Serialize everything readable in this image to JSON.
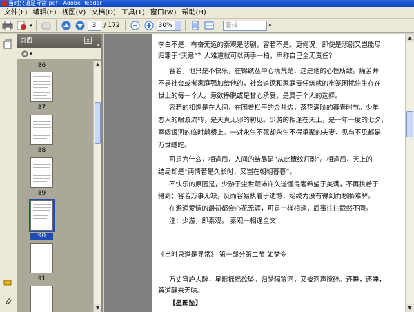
{
  "window": {
    "title": "当时只道是寻常.pdf - Adobe Reader"
  },
  "menu": [
    "文件(F)",
    "编辑(E)",
    "视图(V)",
    "文档(D)",
    "工具(T)",
    "窗口(W)",
    "帮助(H)"
  ],
  "toolbar": {
    "current_page": "3",
    "total_pages": "/ 172",
    "zoom": "30%",
    "search_placeholder": "查找"
  },
  "panel": {
    "title": "页面",
    "close": "x",
    "options_icon": "gear-icon",
    "thumbnails": [
      {
        "label": "86",
        "selected": false
      },
      {
        "label": "87",
        "selected": false
      },
      {
        "label": "88",
        "selected": false
      },
      {
        "label": "89",
        "selected": false
      },
      {
        "label": "90",
        "selected": true
      },
      {
        "label": "91",
        "selected": false
      }
    ]
  },
  "document": {
    "lines": [
      "李白不是：有奋无运的秦观是悲剧，容若不是。更何况，即使是悲剧又岂能尽",
      "归罪于“天意”？人难道就可以两手一拍，声称自己全无责任？",
      "容若，他只是不快乐，在锦绣丛中心境荒芜，这是他的心性所致。痛苦并",
      "不是社会或者家庭强加给他的，社会道德和家庭责任筑就的牢笼困扰住生存在",
      "世上的每一个人。意欲挣脱或是甘心承受，是属于个人的选择。",
      "容若的相逢是在人间，在围着栏干的金井边，落花满阶的暮春时节。少年",
      "恋人的眼波流转，是天真无邪的初见。少游的相逢在天上，是一年一度的七夕，",
      "室阔银河的临时鹊桥上。一对永生不死却永生不得重聚的夫妻，见与不见都是",
      "万世蹉跎。",
      "可是为什么，相逢后，人间的结局是“从此簟纹灯影”。相逢后，天上的",
      "结局却是“两情若是久长时，又岂在朝朝暮暮”。",
      "不快乐的原因是，少游于尘世颠沛许久遂懂得奢希望于美满，不再执着于",
      "得到；容若万事无缺，反而容易执着于遗憾，始终为没有得到而愁肠难解。",
      "在邂逅爱情的最初都会心花无涯，可是一样相逢，后事往往截然不同。",
      "注：少游，即秦观。 秦观一相逢全文",
      "《当时只道是寻常》 第一部分第二节 如梦令",
      "万丈穹庐人醉，星影摇摇欲坠。归梦隔狼河，又被河声搅碎。还睡，还睡，",
      "解道醒来无味。",
      "【星影坠】"
    ]
  }
}
